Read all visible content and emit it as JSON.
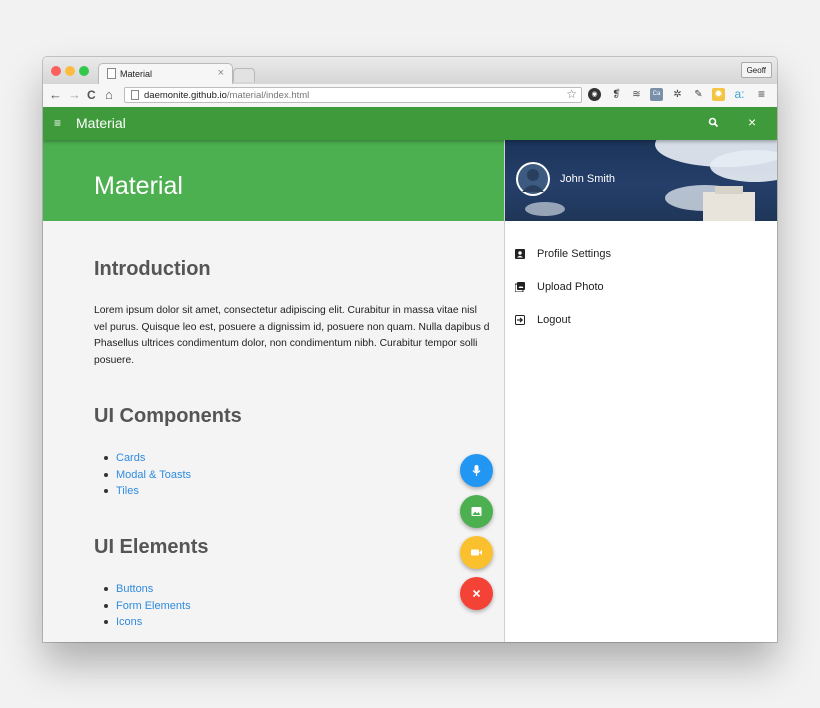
{
  "browser": {
    "tab_title": "Material",
    "tab_close": "×",
    "profile_name": "Geoff",
    "url_domain": "daemonite.github.io",
    "url_path": "/material/index.html"
  },
  "appbar": {
    "menu_icon": "≡",
    "title": "Material",
    "close_icon": "×",
    "color": "#3f9a3c"
  },
  "hero": {
    "title": "Material",
    "color": "#4caf50"
  },
  "content": {
    "intro_heading": "Introduction",
    "intro_lines": [
      "Lorem ipsum dolor sit amet, consectetur adipiscing elit. Curabitur in massa vitae nisl",
      "vel purus. Quisque leo est, posuere a dignissim id, posuere non quam. Nulla dapibus d",
      "Phasellus ultrices condimentum dolor, non condimentum nibh. Curabitur tempor solli",
      "posuere."
    ],
    "components_heading": "UI Components",
    "components": [
      "Cards",
      "Modal & Toasts",
      "Tiles"
    ],
    "elements_heading": "UI Elements",
    "elements": [
      "Buttons",
      "Form Elements",
      "Icons"
    ]
  },
  "fabs": [
    {
      "name": "mic-fab",
      "icon": "mic-icon",
      "color": "#2196f3"
    },
    {
      "name": "image-fab",
      "icon": "image-icon",
      "color": "#4caf50"
    },
    {
      "name": "video-fab",
      "icon": "videocam-icon",
      "color": "#fbc02d"
    },
    {
      "name": "close-fab",
      "icon": "close-icon",
      "color": "#f44336"
    }
  ],
  "drawer": {
    "user_name": "John Smith",
    "items": [
      {
        "label": "Profile Settings",
        "icon": "account-box-icon"
      },
      {
        "label": "Upload Photo",
        "icon": "photo-library-icon"
      },
      {
        "label": "Logout",
        "icon": "exit-icon"
      }
    ]
  }
}
